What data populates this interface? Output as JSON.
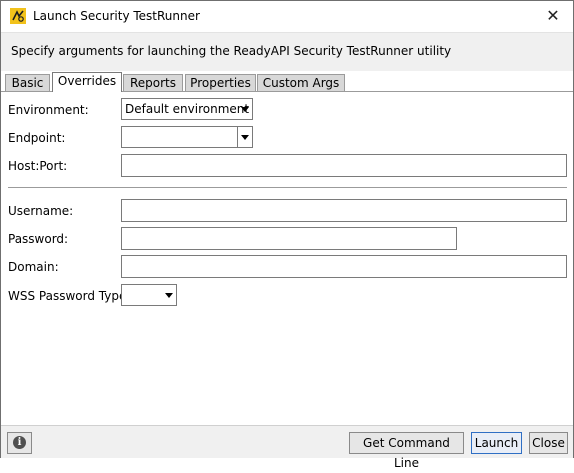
{
  "window": {
    "title": "Launch Security TestRunner"
  },
  "banner": {
    "text": "Specify arguments for launching the ReadyAPI Security TestRunner utility"
  },
  "tabs": [
    {
      "label": "Basic"
    },
    {
      "label": "Overrides"
    },
    {
      "label": "Reports"
    },
    {
      "label": "Properties"
    },
    {
      "label": "Custom Args"
    }
  ],
  "active_tab": "Overrides",
  "form": {
    "environment_label": "Environment:",
    "environment_value": "Default environment",
    "endpoint_label": "Endpoint:",
    "endpoint_value": "",
    "hostport_label": "Host:Port:",
    "hostport_value": "",
    "username_label": "Username:",
    "username_value": "",
    "password_label": "Password:",
    "password_value": "",
    "domain_label": "Domain:",
    "domain_value": "",
    "wss_label": "WSS Password Type:",
    "wss_value": ""
  },
  "footer": {
    "get_command_line": "Get Command Line",
    "launch": "Launch",
    "close": "Close"
  },
  "icons": {
    "app": "readyapi-app-icon",
    "close": "close-icon",
    "info": "info-icon",
    "dropdown": "chevron-down-icon"
  }
}
